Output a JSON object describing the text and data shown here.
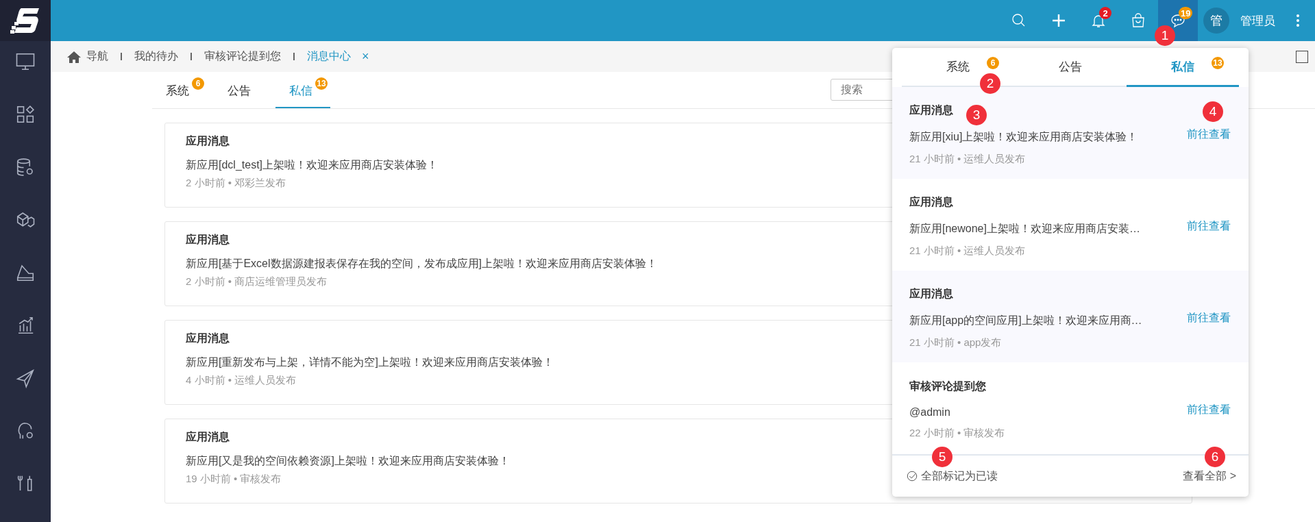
{
  "topbar": {
    "notification_count": "2",
    "message_count": "19",
    "avatar": "管",
    "user": "管理员"
  },
  "breadcrumb": [
    {
      "label": "导航",
      "kind": "home",
      "selected": false
    },
    {
      "label": "我的待办",
      "kind": "page",
      "selected": false
    },
    {
      "label": "审核评论提到您",
      "kind": "page",
      "selected": false
    },
    {
      "label": "消息中心",
      "kind": "page",
      "selected": true,
      "close": "×"
    }
  ],
  "tabs": [
    {
      "label": "系统",
      "count": "6",
      "selected": false
    },
    {
      "label": "公告",
      "selected": false
    },
    {
      "label": "私信",
      "count": "13",
      "selected": true
    }
  ],
  "search": {
    "placeholder": "搜索"
  },
  "messages": [
    {
      "title": "应用消息",
      "body": "新应用[dcl_test]上架啦！欢迎来应用商店安装体验！",
      "meta": "2 小时前 • 邓彩兰发布"
    },
    {
      "title": "应用消息",
      "body": "新应用[基于Excel数据源建报表保存在我的空间，发布成应用]上架啦！欢迎来应用商店安装体验！",
      "meta": "2 小时前 • 商店运维管理员发布"
    },
    {
      "title": "应用消息",
      "body": "新应用[重新发布与上架，详情不能为空]上架啦！欢迎来应用商店安装体验！",
      "meta": "4 小时前 • 运维人员发布"
    },
    {
      "title": "应用消息",
      "body": "新应用[又是我的空间依赖资源]上架啦！欢迎来应用商店安装体验！",
      "meta": "19 小时前 • 审核发布"
    }
  ],
  "popup": {
    "tabs": [
      {
        "label": "系统",
        "count": "6",
        "selected": false
      },
      {
        "label": "公告",
        "selected": false
      },
      {
        "label": "私信",
        "count": "13",
        "selected": true
      }
    ],
    "items": [
      {
        "title": "应用消息",
        "body": "新应用[xiu]上架啦！欢迎来应用商店安装体验！",
        "meta": "21 小时前 • 运维人员发布",
        "link": "前往查看"
      },
      {
        "title": "应用消息",
        "body": "新应用[newone]上架啦！欢迎来应用商店安装…",
        "meta": "21 小时前 • 运维人员发布",
        "link": "前往查看"
      },
      {
        "title": "应用消息",
        "body": "新应用[app的空间应用]上架啦！欢迎来应用商…",
        "meta": "21 小时前 • app发布",
        "link": "前往查看"
      },
      {
        "title": "审核评论提到您",
        "body": "@admin",
        "meta": "22 小时前 • 审核发布",
        "link": "前往查看"
      }
    ],
    "mark_all": "全部标记为已读",
    "view_all": "查看全部 >"
  },
  "callouts": [
    "1",
    "2",
    "3",
    "4",
    "5",
    "6"
  ]
}
